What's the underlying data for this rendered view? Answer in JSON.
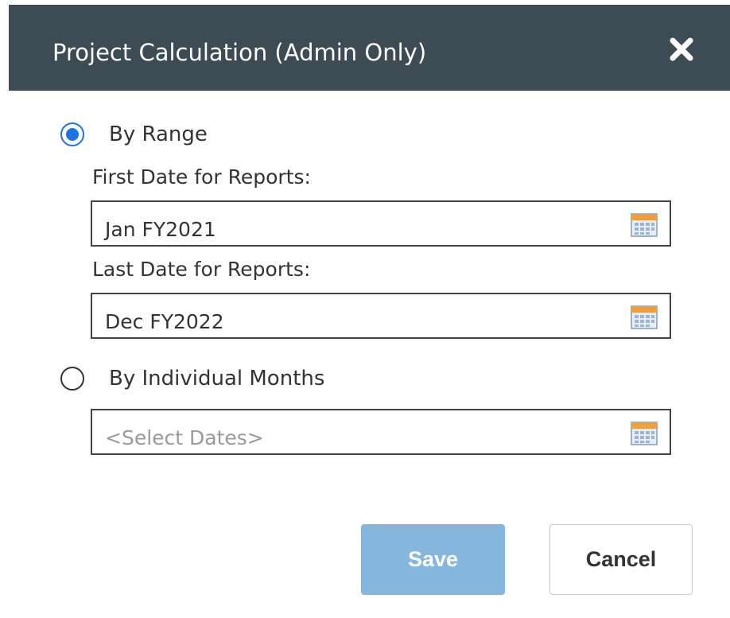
{
  "dialog": {
    "title": "Project Calculation (Admin Only)",
    "close_icon": "close-icon"
  },
  "options": {
    "by_range": {
      "label": "By Range",
      "selected": true
    },
    "by_individual_months": {
      "label": "By Individual Months",
      "selected": false
    }
  },
  "range": {
    "first_date_label": "First Date for Reports:",
    "first_date_value": "Jan FY2021",
    "last_date_label": "Last Date for Reports:",
    "last_date_value": "Dec FY2022"
  },
  "months": {
    "placeholder": "<Select Dates>"
  },
  "buttons": {
    "save_label": "Save",
    "cancel_label": "Cancel"
  },
  "colors": {
    "header_bg": "#3d4b54",
    "accent": "#1a73e8",
    "save_bg": "#85b7de"
  },
  "icons": {
    "calendar": "calendar-icon"
  }
}
